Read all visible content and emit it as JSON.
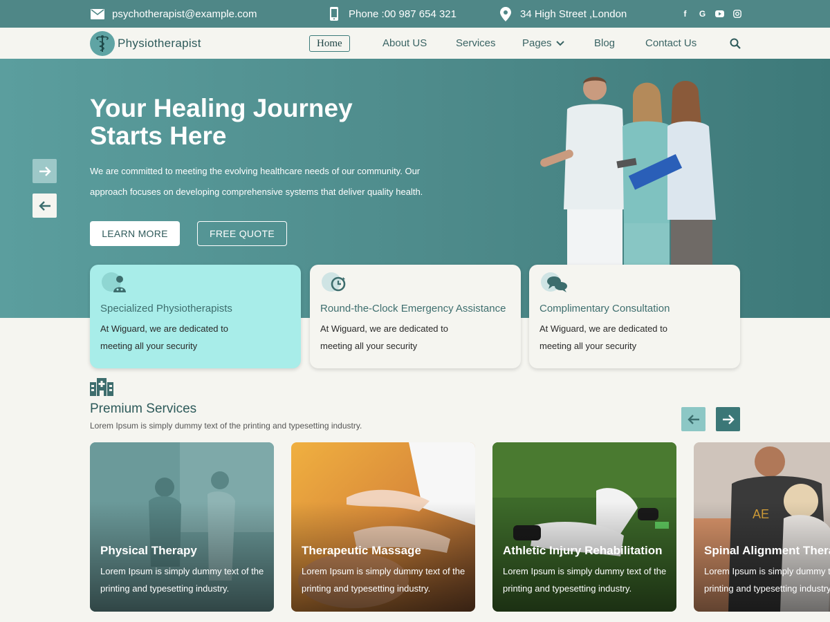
{
  "topbar": {
    "email": "psychotherapist@example.com",
    "phone": "Phone :00 987 654 321",
    "address": "34 High Street ,London",
    "socials": [
      "facebook-icon",
      "google-icon",
      "youtube-icon",
      "instagram-icon"
    ]
  },
  "nav": {
    "brand": "Physiotherapist",
    "links": [
      "Home",
      "About US",
      "Services",
      "Pages",
      "Blog",
      "Contact Us"
    ]
  },
  "hero": {
    "title": "Your Healing Journey Starts Here",
    "text": "We are committed to meeting the evolving healthcare needs of our community. Our approach focuses on developing comprehensive systems that deliver quality health.",
    "learn_more": "LEARN MORE",
    "free_quote": "FREE QUOTE"
  },
  "features": [
    {
      "title": "Specialized Physiotherapists",
      "desc": "At Wiguard, we are dedicated to meeting all your security"
    },
    {
      "title": "Round-the-Clock Emergency Assistance",
      "desc": "At Wiguard, we are dedicated to meeting all your security"
    },
    {
      "title": "Complimentary Consultation",
      "desc": "At Wiguard, we are dedicated to meeting all your security"
    }
  ],
  "services": {
    "title": "Premium Services",
    "subtitle": "Lorem Ipsum is simply dummy text of the printing and typesetting industry.",
    "cards": [
      {
        "title": "Physical Therapy",
        "desc": "Lorem Ipsum is simply dummy text of the printing and typesetting industry."
      },
      {
        "title": "Therapeutic Massage",
        "desc": "Lorem Ipsum is simply dummy text of the printing and typesetting industry."
      },
      {
        "title": "Athletic Injury Rehabilitation",
        "desc": "Lorem Ipsum is simply dummy text of the printing and typesetting industry."
      },
      {
        "title": "Spinal Alignment Therapy",
        "desc": "Lorem Ipsum is simply dummy text of the printing and typesetting industry."
      }
    ]
  },
  "colors": {
    "primary": "#4f8787",
    "accent_light": "#a8ede9",
    "background": "#f5f5f0"
  }
}
